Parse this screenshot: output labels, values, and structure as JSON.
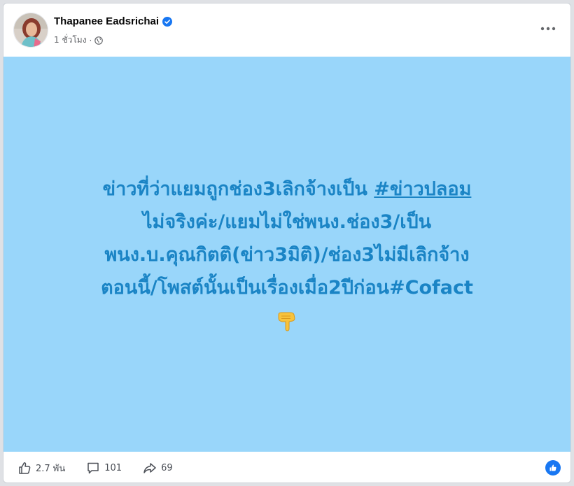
{
  "post": {
    "author": "Thapanee Eadsrichai",
    "time": "1 ชั่วโมง",
    "separator": "·",
    "text_lines": [
      "ข่าวที่ว่าแยมถูกช่อง3เลิกจ้างเป็น ",
      "ไม่จริงค่ะ/แยมไม่ใช่พนง.ช่อง3/เป็น",
      "พนง.บ.คุณกิตติ(ข่าว3มิติ)/ช่อง3ไม่มีเลิกจ้าง",
      "ตอนนี้/โพสต์นั้นเป็นเรื่องเมื่อ2ปีก่อน#Cofact"
    ],
    "hashtag": "#ข่าวปลอม",
    "background_color": "#99d6fa",
    "text_color": "#1a84c5",
    "emoji": "pointing-down-hand-icon"
  },
  "footer": {
    "likes": "2.7 พัน",
    "comments": "101",
    "shares": "69"
  },
  "colors": {
    "verified": "#1877f2",
    "reaction": "#1877f2"
  }
}
